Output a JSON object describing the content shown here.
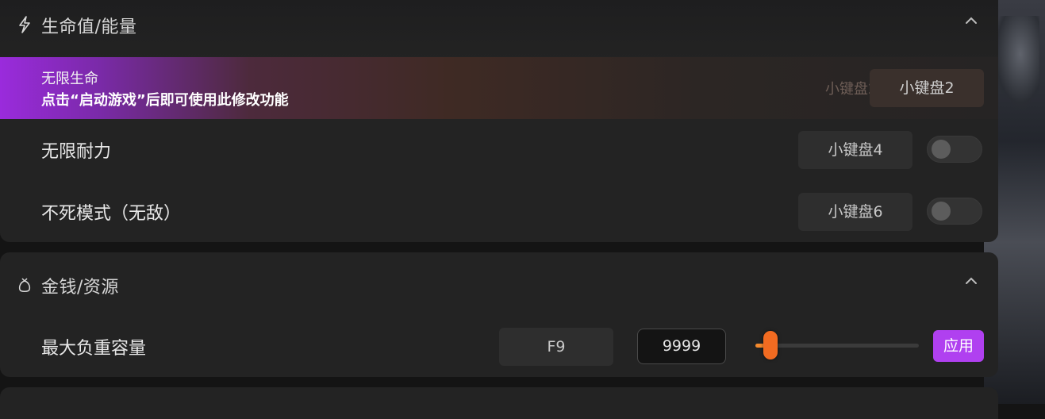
{
  "sections": [
    {
      "title": "生命值/能量",
      "icon": "lightning-icon",
      "rows": [
        {
          "label": "无限生命",
          "hotkey": "小键盘2"
        },
        {
          "label": "无限耐力",
          "hotkey": "小键盘4",
          "enabled": false
        },
        {
          "label": "不死模式（无敌）",
          "hotkey": "小键盘6",
          "enabled": false
        }
      ],
      "tooltip": "点击“启动游戏”后即可使用此修改功能",
      "ghost_hotkey": "小键盘2"
    },
    {
      "title": "金钱/资源",
      "icon": "money-bag-icon",
      "rows": [
        {
          "label": "最大负重容量",
          "hotkey": "F9",
          "value": "9999",
          "slider_fraction": 0.09,
          "apply_label": "应用"
        }
      ]
    }
  ],
  "colors": {
    "accent_purple": "#b040f0",
    "slider_orange": "#f26b21"
  }
}
